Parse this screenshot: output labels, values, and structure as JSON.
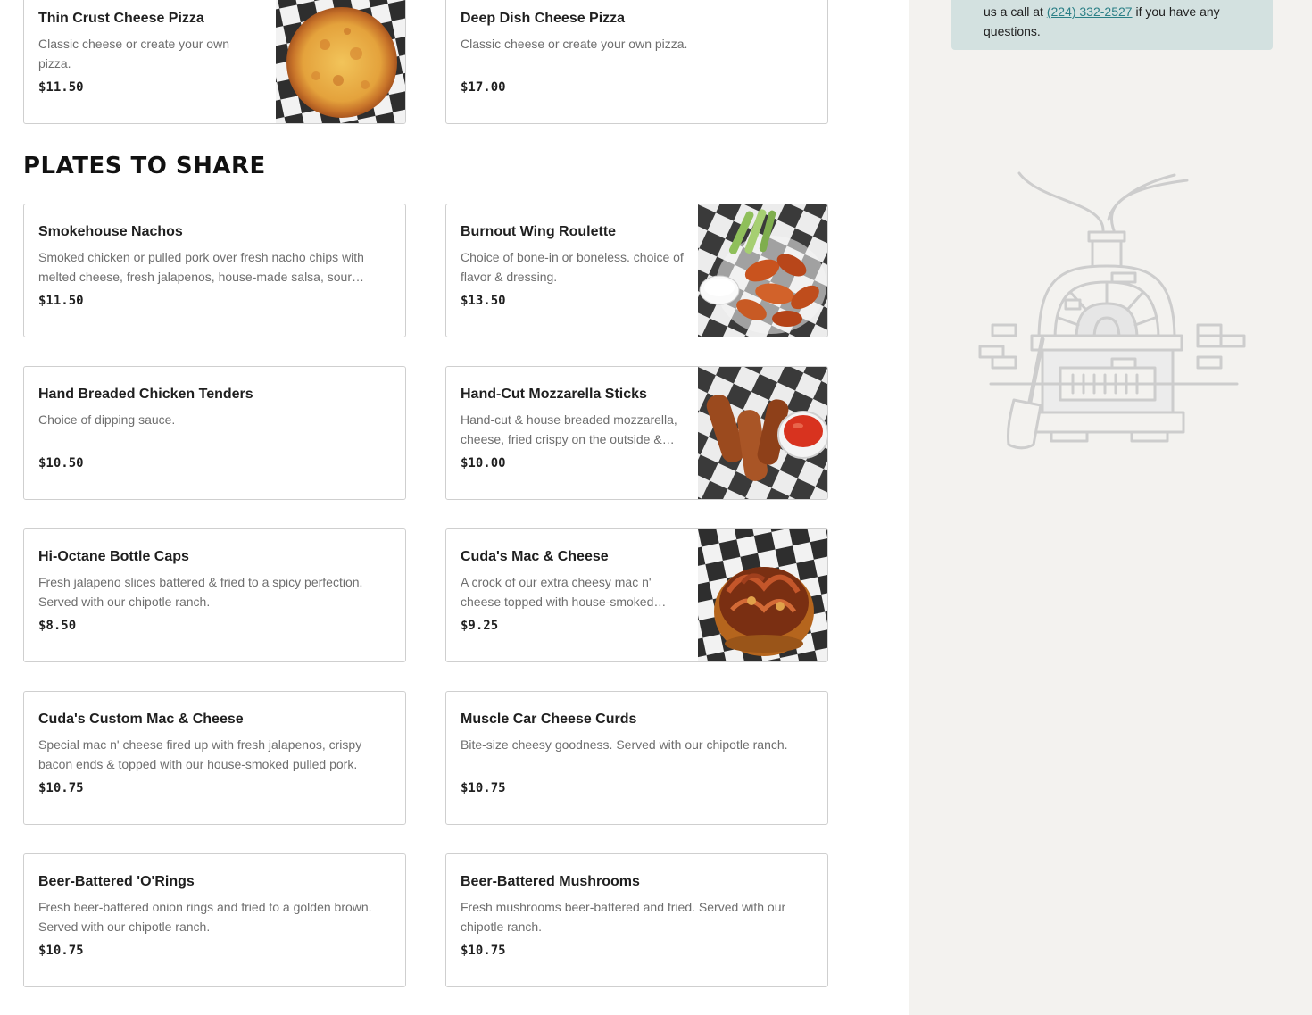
{
  "sections": {
    "plates_title": "PLATES TO SHARE"
  },
  "items": [
    {
      "name": "Thin Crust Cheese Pizza",
      "description": "Classic cheese or create your own pizza.",
      "price": "$11.50",
      "image": "cheese-pizza-photo"
    },
    {
      "name": "Deep Dish Cheese Pizza",
      "description": "Classic cheese or create your own pizza.",
      "price": "$17.00"
    },
    {
      "name": "Smokehouse Nachos",
      "description": "Smoked chicken or pulled pork over fresh nacho chips with melted cheese, fresh jalapenos, house-made salsa, sour cream, and guacamole.",
      "price": "$11.50"
    },
    {
      "name": "Burnout Wing Roulette",
      "description": "Choice of bone-in or boneless. choice of flavor & dressing.",
      "price": "$13.50",
      "image": "chicken-wings-photo"
    },
    {
      "name": "Hand Breaded Chicken Tenders",
      "description": "Choice of dipping sauce.",
      "price": "$10.50"
    },
    {
      "name": "Hand-Cut Mozzarella Sticks",
      "description": "Hand-cut & house breaded mozzarella, cheese, fried crispy on the outside & gooey on the inside.",
      "price": "$10.00",
      "image": "mozzarella-sticks-photo"
    },
    {
      "name": "Hi-Octane Bottle Caps",
      "description": "Fresh jalapeno slices battered & fried to a spicy perfection. Served with our chipotle ranch.",
      "price": "$8.50"
    },
    {
      "name": "Cuda's Mac & Cheese",
      "description": "A crock of our extra cheesy mac n' cheese topped with house-smoked pulled pork.",
      "price": "$9.25",
      "image": "mac-and-cheese-photo"
    },
    {
      "name": "Cuda's Custom Mac & Cheese",
      "description": "Special mac n' cheese fired up with fresh jalapenos, crispy bacon ends & topped with our house-smoked pulled pork.",
      "price": "$10.75"
    },
    {
      "name": "Muscle Car Cheese Curds",
      "description": "Bite-size cheesy goodness. Served with our chipotle ranch.",
      "price": "$10.75"
    },
    {
      "name": "Beer-Battered 'O'Rings",
      "description": "Fresh beer-battered onion rings and fried to a golden brown. Served with our chipotle ranch.",
      "price": "$10.75"
    },
    {
      "name": "Beer-Battered Mushrooms",
      "description": "Fresh mushrooms beer-battered and fried. Served with our chipotle ranch.",
      "price": "$10.75"
    }
  ],
  "sidebar": {
    "info_prefix": "us a call at",
    "phone": "(224) 332-2527",
    "info_suffix": "if you have any questions.",
    "illustration": "pizza-oven-illustration"
  },
  "colors": {
    "sidebar_bg": "#f3f2ef",
    "info_bg": "#d3e1e0",
    "link": "#2b7f86",
    "card_border": "#cfcfcf"
  }
}
